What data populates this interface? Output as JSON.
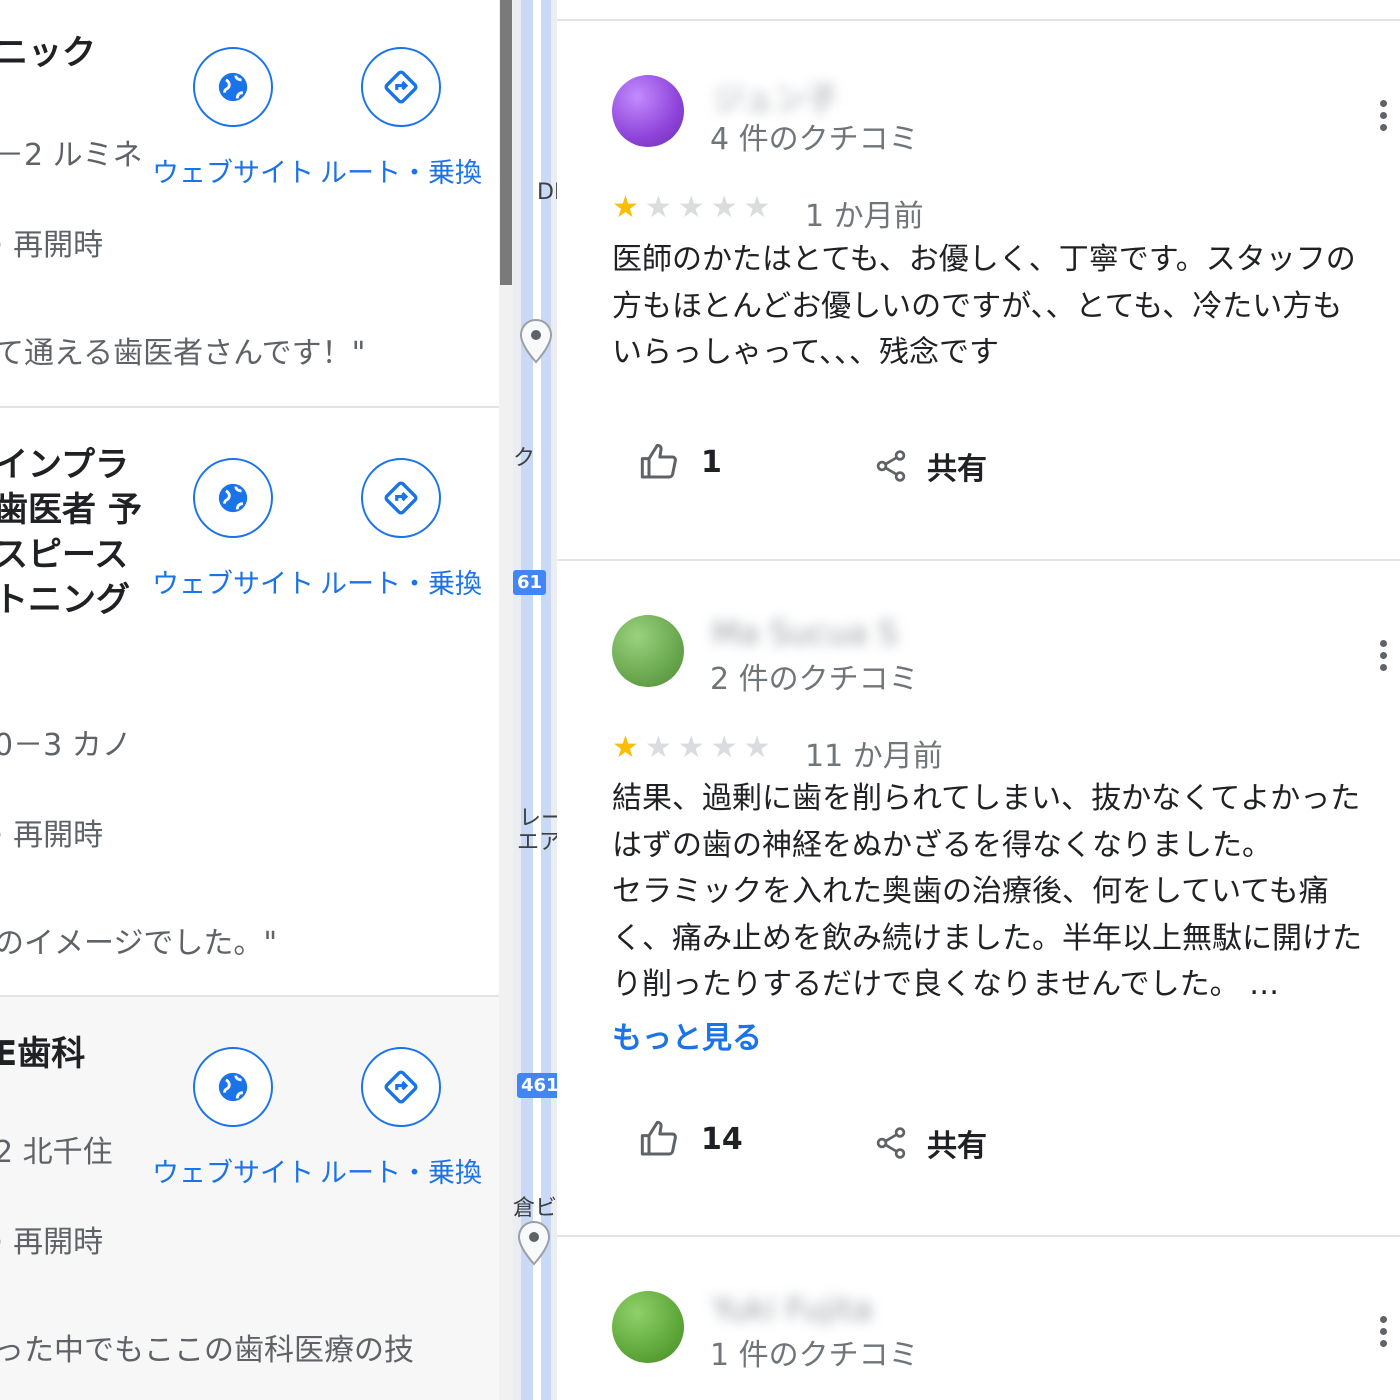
{
  "left_list": {
    "places": [
      {
        "name_lines": [
          "ニック"
        ],
        "address": "－2 ルミネ",
        "hours": "· 再開時",
        "quote": "て通える歯医者さんです！\"",
        "website_label": "ウェブサイト",
        "route_label": "ルート・乗換"
      },
      {
        "name_lines": [
          "インプラ",
          "歯医者 予",
          "スピース",
          "トニング"
        ],
        "address": "0－3 カノ",
        "hours": "· 再開時",
        "quote": "のイメージでした。\"",
        "website_label": "ウェブサイト",
        "route_label": "ルート・乗換"
      },
      {
        "name_lines": [
          "E歯科"
        ],
        "address": "2 北千住",
        "hours": "· 再開時",
        "quote": "った中でもここの歯科医療の技",
        "website_label": "ウェブサイト",
        "route_label": "ルート・乗換"
      }
    ]
  },
  "map": {
    "labels": [
      "DE",
      "ク",
      "レー",
      "エア",
      "倉ビ"
    ],
    "route_badges": [
      "61",
      "461"
    ]
  },
  "reviews": [
    {
      "author": "ジュン子",
      "review_count": "4 件のクチコミ",
      "rating": 1,
      "max_rating": 5,
      "date": "1 か月前",
      "text": "医師のかたはとても、お優しく、丁寧です。スタッフの\n方もほとんどお優しいのですが、、とても、冷たい方も\nいらっしゃって、、、残念です",
      "likes": "1",
      "share_label": "共有",
      "avatar_color": "#8e44d9"
    },
    {
      "author": "Ma Sucua S",
      "review_count": "2 件のクチコミ",
      "rating": 1,
      "max_rating": 5,
      "date": "11 か月前",
      "text": "結果、過剰に歯を削られてしまい、抜かなくてよかった\nはずの歯の神経をぬかざるを得なくなりました。\nセラミックを入れた奥歯の治療後、何をしていても痛\nく、痛み止めを飲み続けました。半年以上無駄に開けた\nり削ったりするだけで良くなりませんでした。 …",
      "more_label": "もっと見る",
      "likes": "14",
      "share_label": "共有",
      "avatar_color": "#6aa84f"
    },
    {
      "author": "Yuki Fujita",
      "review_count": "1 件のクチコミ",
      "avatar_color": "#5fa83a"
    }
  ]
}
